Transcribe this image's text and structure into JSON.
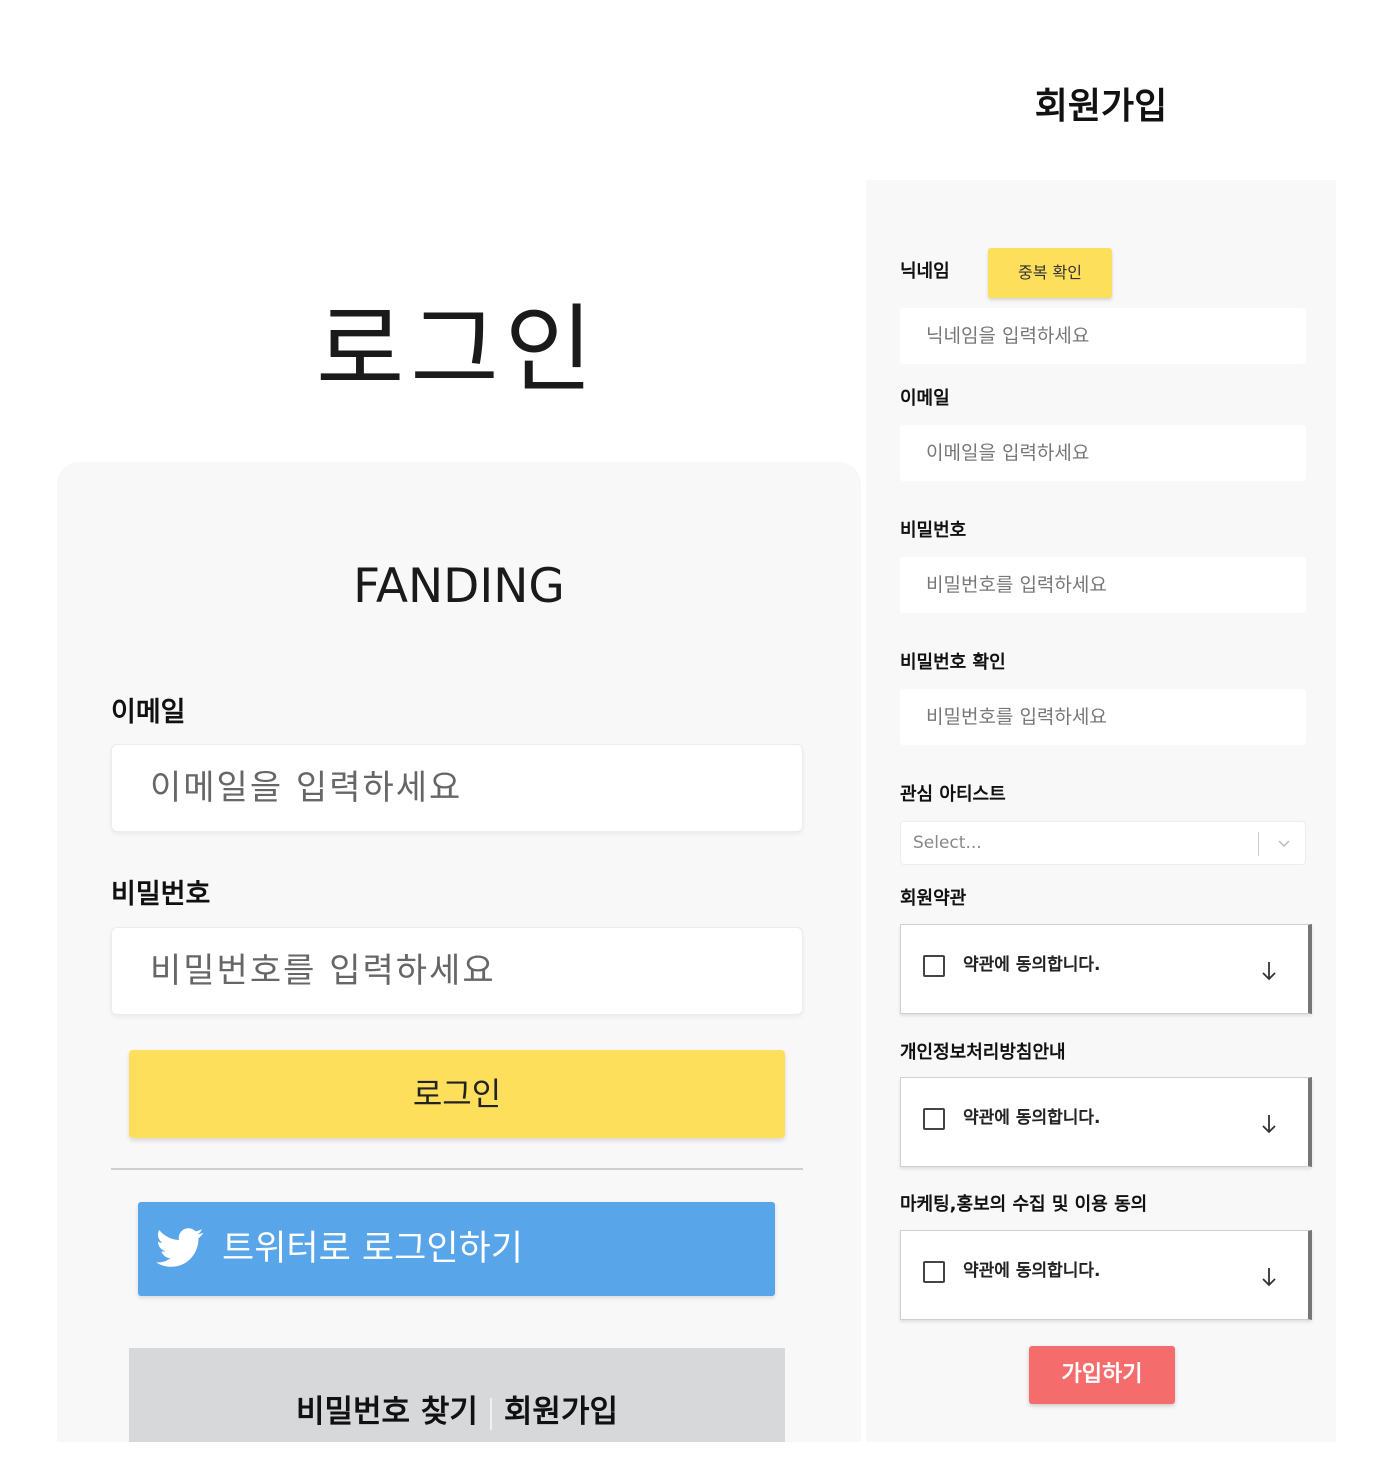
{
  "login": {
    "title": "로그인",
    "brand": "FANDING",
    "email_label": "이메일",
    "email_placeholder": "이메일을 입력하세요",
    "password_label": "비밀번호",
    "password_placeholder": "비밀번호를 입력하세요",
    "login_button": "로그인",
    "twitter_button": "트위터로 로그인하기",
    "find_password": "비밀번호 찾기",
    "signup_link": "회원가입"
  },
  "signup": {
    "title": "회원가입",
    "nickname_label": "닉네임",
    "duplicate_check": "중복 확인",
    "nickname_placeholder": "닉네임을 입력하세요",
    "email_label": "이메일",
    "email_placeholder": "이메일을 입력하세요",
    "password_label": "비밀번호",
    "password_placeholder": "비밀번호를 입력하세요",
    "password_confirm_label": "비밀번호 확인",
    "password_confirm_placeholder": "비밀번호를 입력하세요",
    "artist_label": "관심 아티스트",
    "artist_select": "Select...",
    "terms": [
      {
        "label": "회원약관",
        "agree": "약관에 동의합니다."
      },
      {
        "label": "개인정보처리방침안내",
        "agree": "약관에 동의합니다."
      },
      {
        "label": "마케팅,홍보의 수집 및 이용 동의",
        "agree": "약관에 동의합니다."
      }
    ],
    "join_button": "가입하기"
  },
  "colors": {
    "yellow": "#fddf5c",
    "twitter_blue": "#58a5e9",
    "join_red": "#f56c6c",
    "card_bg": "#f8f8f8"
  },
  "icons": [
    "twitter-icon",
    "chevron-down-icon",
    "arrow-down-icon",
    "checkbox-icon"
  ]
}
